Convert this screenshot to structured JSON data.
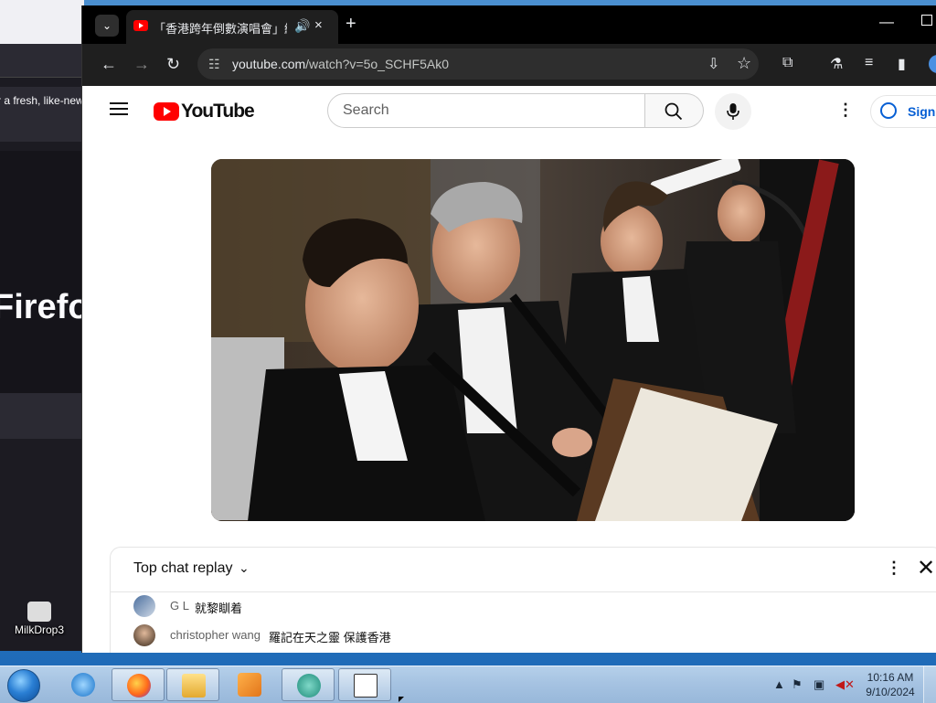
{
  "desktop": {
    "icon_label": "MilkDrop3"
  },
  "firefox": {
    "notice_text": "r a fresh, like-new",
    "hero_text": "Firefo"
  },
  "chrome": {
    "tab": {
      "title": "「香港跨年倒數演唱會」線上",
      "audio_icon": "speaker-icon",
      "close_symbol": "×"
    },
    "new_tab_symbol": "+",
    "url_host": "youtube.com",
    "url_path": "/watch?v=5o_SCHF5Ak0"
  },
  "youtube": {
    "logo_text": "YouTube",
    "search_placeholder": "Search",
    "signin_label": "Sign"
  },
  "chat": {
    "title": "Top chat replay",
    "messages": [
      {
        "author": "G L",
        "text": "就黎瞓着"
      },
      {
        "author": "christopher wang",
        "text": "羅記在天之靈 保護香港"
      }
    ]
  },
  "taskbar": {
    "time": "10:16 AM",
    "date": "9/10/2024"
  },
  "colors": {
    "yt_red": "#ff0000",
    "signin_blue": "#065fd4",
    "chrome_dark": "#1f1f1f"
  }
}
